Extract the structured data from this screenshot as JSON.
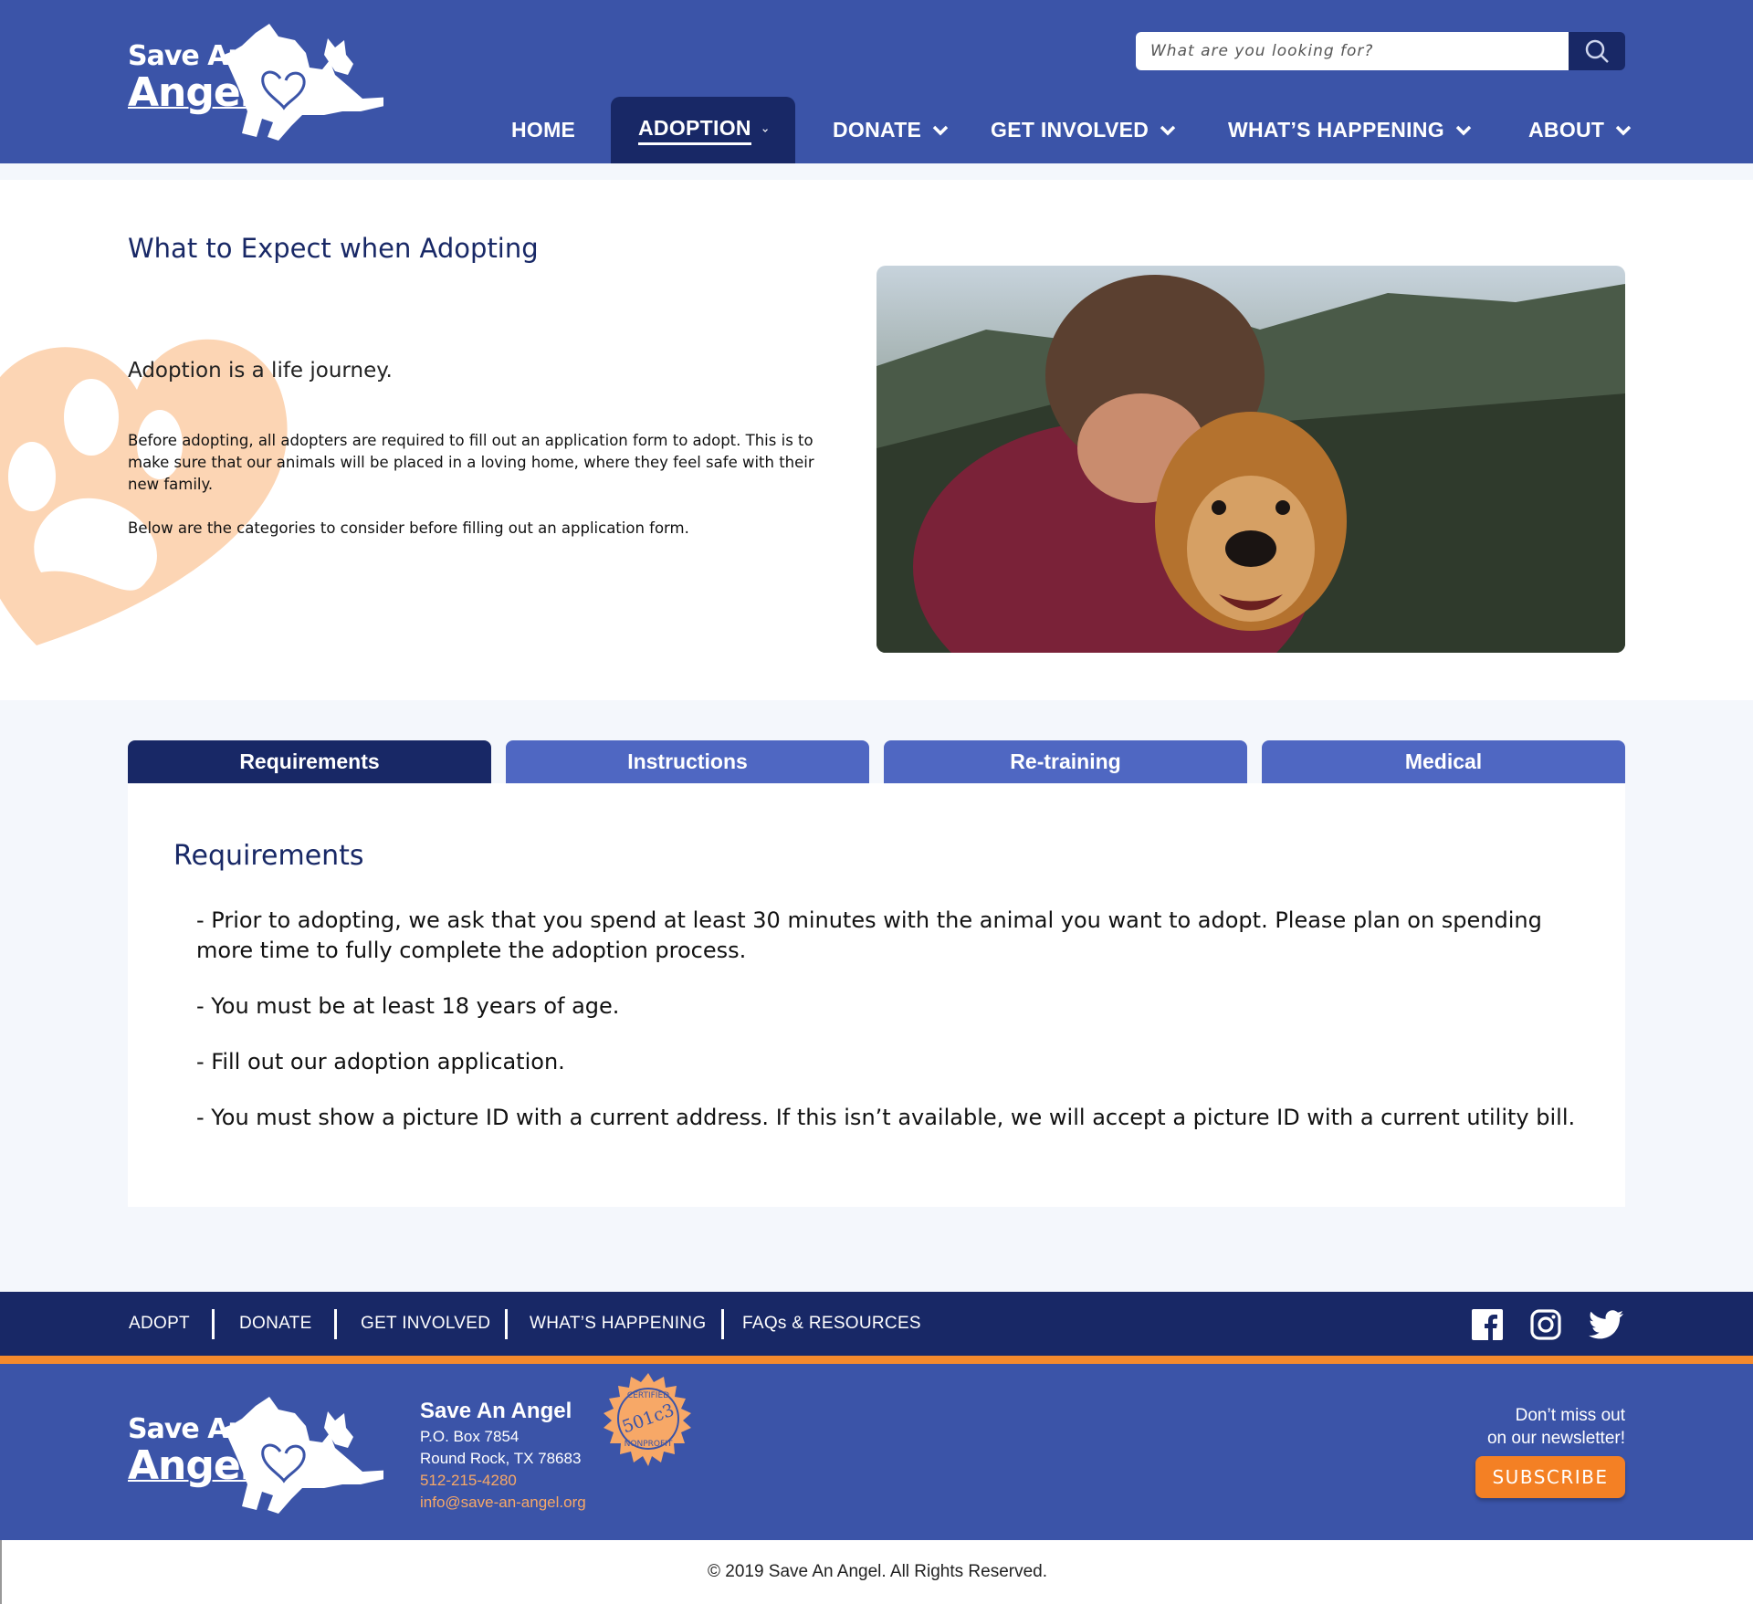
{
  "brand": {
    "logo_line1": "Save An",
    "logo_line2": "Angel",
    "colors": {
      "primary": "#3b54a8",
      "dark": "#182866",
      "tab": "#4f67c2",
      "accent": "#f48024",
      "heart": "#fcd5b4"
    }
  },
  "search": {
    "placeholder": "What are you looking for?",
    "icon": "search-icon"
  },
  "nav": [
    {
      "label": "HOME",
      "dropdown": false
    },
    {
      "label": "ADOPTION",
      "dropdown": true,
      "active": true
    },
    {
      "label": "DONATE",
      "dropdown": true
    },
    {
      "label": "GET INVOLVED",
      "dropdown": true
    },
    {
      "label": "WHAT’S HAPPENING",
      "dropdown": true
    },
    {
      "label": "ABOUT",
      "dropdown": true
    }
  ],
  "intro": {
    "title": "What to Expect when Adopting",
    "subtitle": "Adoption is a life journey.",
    "p1": "Before adopting, all adopters are required to fill out an application form to adopt. This is to make sure that our animals will be placed in a loving home, where they feel safe with their new family.",
    "p2": "Below are the categories to consider before filling out an application form."
  },
  "tabs": [
    {
      "label": "Requirements",
      "active": true
    },
    {
      "label": "Instructions"
    },
    {
      "label": "Re-training"
    },
    {
      "label": "Medical"
    }
  ],
  "panel": {
    "title": "Requirements",
    "items": [
      "- Prior to adopting, we ask that you spend at least 30 minutes with the animal you want to adopt. Please plan on spending more time to fully complete the adoption process.",
      "- You must be at least 18 years of age.",
      "- Fill out our adoption application.",
      "- You must show a picture ID with a current address. If this isn’t available, we will accept a picture ID with a current utility bill."
    ]
  },
  "footer": {
    "nav": [
      "ADOPT",
      "DONATE",
      "GET INVOLVED",
      "WHAT’S HAPPENING",
      "FAQs & RESOURCES"
    ],
    "social": [
      "facebook-icon",
      "instagram-icon",
      "twitter-icon"
    ],
    "org_name": "Save An Angel",
    "address1": "P.O. Box 7854",
    "address2": "Round Rock, TX 78683",
    "phone": "512-215-4280",
    "email": "info@save-an-angel.org",
    "badge_top": "CERTIFIED",
    "badge_mid": "501c3",
    "badge_bottom": "NONPROFIT",
    "newsletter1": "Don’t miss out",
    "newsletter2": "on our newsletter!",
    "subscribe": "SUBSCRIBE",
    "copyright": "© 2019 Save An Angel. All Rights Reserved."
  }
}
